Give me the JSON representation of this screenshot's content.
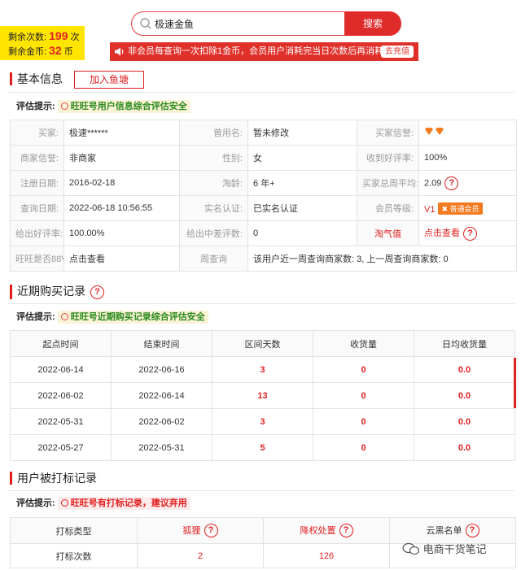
{
  "quota": {
    "times_label": "剩余次数:",
    "times_value": "199",
    "times_unit": "次",
    "coins_label": "剩余金币:",
    "coins_value": "32",
    "coins_unit": "币"
  },
  "search": {
    "value": "极速金鱼",
    "button": "搜索"
  },
  "notice": {
    "text": "非会员每查询一次扣除1金币，会员用户消耗完当日次数后再消耗金币。",
    "recharge": "去充值"
  },
  "basic": {
    "title": "基本信息",
    "add_button": "加入鱼塘",
    "hint_label": "评估提示:",
    "hint_value": "旺旺号用户信息综合评估安全",
    "rows": [
      [
        {
          "l": "买家:",
          "v": "极速******"
        },
        {
          "l": "曾用名:",
          "v": "暂未修改"
        },
        {
          "l": "买家信誉:",
          "v": "💎💎"
        }
      ],
      [
        {
          "l": "商家信誉:",
          "v": "非商家"
        },
        {
          "l": "性别:",
          "v": "女"
        },
        {
          "l": "收到好评率:",
          "v": "100%"
        }
      ],
      [
        {
          "l": "注册日期:",
          "v": "2016-02-18"
        },
        {
          "l": "淘龄:",
          "v": "6 年+"
        },
        {
          "l": "买家总周平均:",
          "v": "2.09"
        }
      ],
      [
        {
          "l": "查询日期:",
          "v": "2022-06-18 10:56:55"
        },
        {
          "l": "实名认证:",
          "v": "已实名认证"
        },
        {
          "l": "会员等级:",
          "v": "V1",
          "badge": "普通会员"
        }
      ],
      [
        {
          "l": "给出好评率:",
          "v": "100.00%"
        },
        {
          "l": "给出中差评数:",
          "v": "0"
        },
        {
          "l": "淘气值",
          "v": "点击查看"
        }
      ],
      [
        {
          "l": "旺旺是否88VIP:",
          "v": "点击查看"
        },
        {
          "l": "周查询",
          "v": "该用户近一周查询商家数:  3,   上一周查询商家数:  0"
        }
      ]
    ]
  },
  "purchase": {
    "title": "近期购买记录",
    "hint_label": "评估提示:",
    "hint_value": "旺旺号近期购买记录综合评估安全",
    "headers": [
      "起点时间",
      "结束时间",
      "区间天数",
      "收货量",
      "日均收货量"
    ],
    "rows": [
      [
        "2022-06-14",
        "2022-06-16",
        "3",
        "0",
        "0.0"
      ],
      [
        "2022-06-02",
        "2022-06-14",
        "13",
        "0",
        "0.0"
      ],
      [
        "2022-05-31",
        "2022-06-02",
        "3",
        "0",
        "0.0"
      ],
      [
        "2022-05-27",
        "2022-05-31",
        "5",
        "0",
        "0.0"
      ]
    ]
  },
  "marked": {
    "title": "用户被打标记录",
    "hint_label": "评估提示:",
    "hint_value": "旺旺号有打标记录，建议弃用",
    "headers": [
      "打标类型",
      "狐狸",
      "降权处置",
      "云黑名单"
    ],
    "row": [
      "打标次数",
      "2",
      "126",
      ""
    ]
  },
  "watermark": "电商干货笔记",
  "colors": {
    "accent": "#e02020",
    "quota_bg": "#ffe500",
    "safe": "#2a8a1f",
    "vip_badge": "#f47a20"
  }
}
